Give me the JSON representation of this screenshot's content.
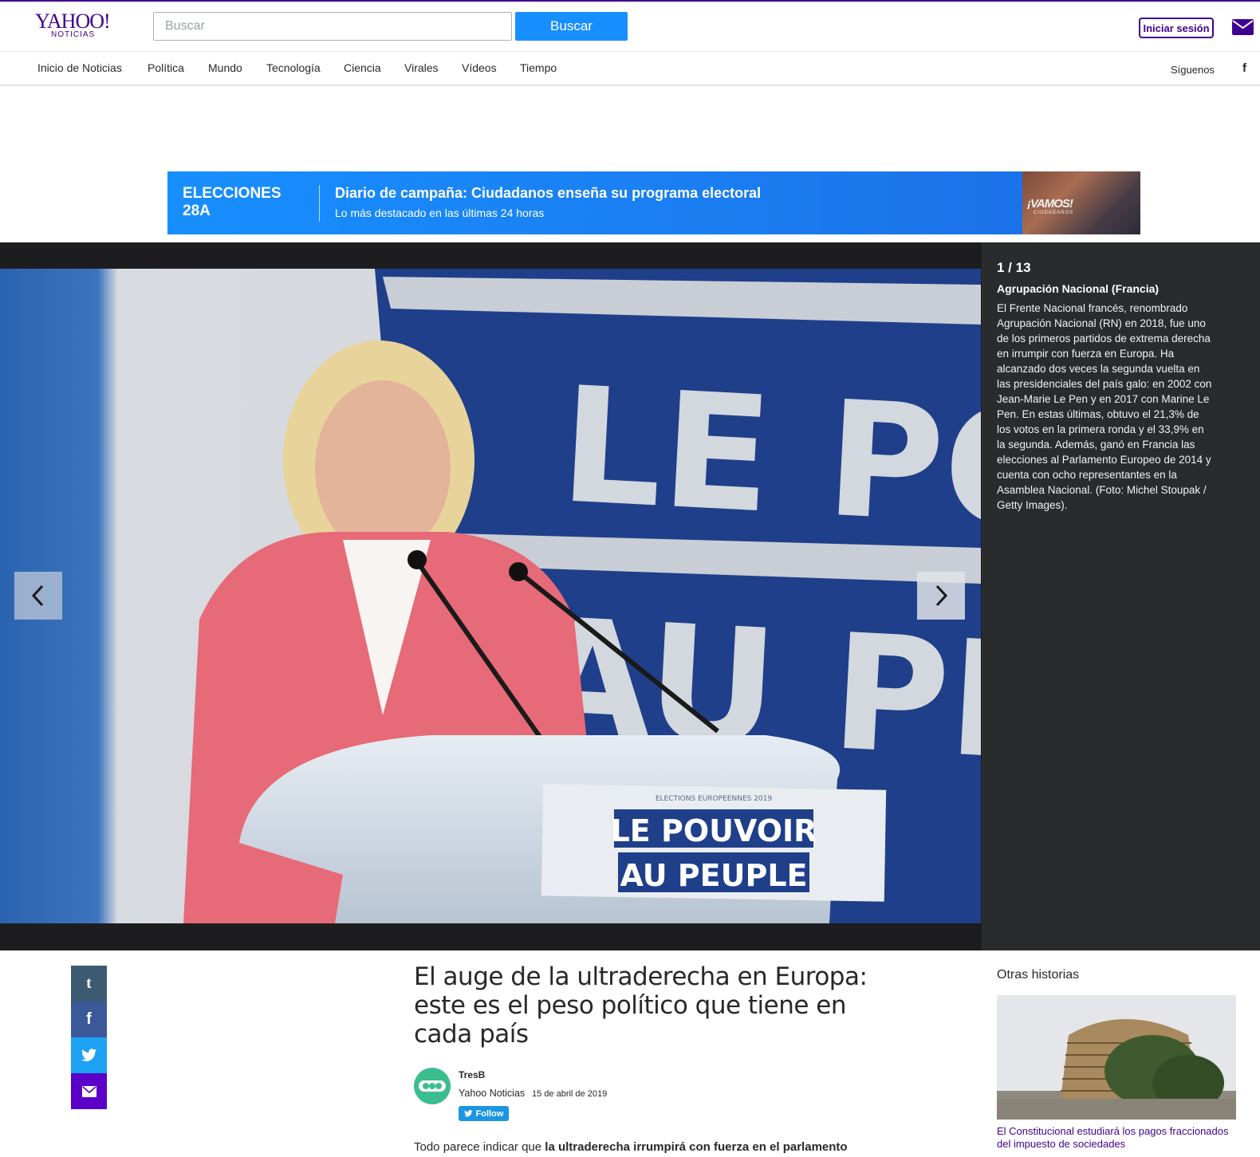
{
  "header": {
    "logo_main": "YAHOO!",
    "logo_sub": "NOTICIAS",
    "search_placeholder": "Buscar",
    "search_button": "Buscar",
    "signin": "Iniciar sesión"
  },
  "nav": {
    "items": [
      "Inicio de Noticias",
      "Política",
      "Mundo",
      "Tecnología",
      "Ciencia",
      "Virales",
      "Vídeos",
      "Tiempo"
    ],
    "follow_label": "Síguenos",
    "facebook": "f"
  },
  "banner": {
    "tag_line1": "ELECCIONES",
    "tag_line2": "28A",
    "title": "Diario de campaña: Ciudadanos enseña su programa electoral",
    "subtitle": "Lo más destacado en las últimas 24 horas",
    "thumb_text": "¡VAMOS!",
    "thumb_sub": "CIUDADANOS"
  },
  "slideshow": {
    "counter": "1 / 13",
    "caption_title": "Agrupación Nacional (Francia)",
    "caption_text": "El Frente Nacional francés, renombrado Agrupación Nacional (RN) en 2018, fue uno de los primeros partidos de extrema derecha en irrumpir con fuerza en Europa. Ha alcanzado dos veces la segunda vuelta en las presidenciales del país galo: en 2002 con Jean-Marie Le Pen y en 2017 con Marine Le Pen. En estas últimas, obtuvo el 21,3% de los votos en la primera ronda y el 33,9% en la segunda. Además, ganó en Francia las elecciones al Parlamento Europeo de 2014 y cuenta con ocho representantes en la Asamblea Nacional. (Foto: Michel Stoupak / Getty Images).",
    "photo_sign_line1": "LE POUVOIR",
    "photo_sign_line2": "AU PEUPLE",
    "photo_sign_small": "ELECTIONS EUROPEENNES 2019",
    "photo_bg_line1": "LE POU",
    "photo_bg_line2": "AU PE"
  },
  "article": {
    "headline": "El auge de la ultraderecha en Europa: este es el peso político que tiene en cada país",
    "author": "TresB",
    "provider": "Yahoo Noticias",
    "date": "15 de abril de 2019",
    "follow": "Follow",
    "lead_plain": "Todo parece indicar que ",
    "lead_bold": "la ultraderecha irrumpirá con fuerza en el parlamento"
  },
  "share": {
    "tumblr": "t",
    "facebook": "f",
    "twitter": "🐦",
    "mail": "✉"
  },
  "sidebar": {
    "heading": "Otras historias",
    "story_title": "El Constitucional estudiará los pagos fraccionados del impuesto de sociedades"
  },
  "colors": {
    "brand": "#400090",
    "search_button": "#188fff",
    "banner": "#188fff"
  }
}
